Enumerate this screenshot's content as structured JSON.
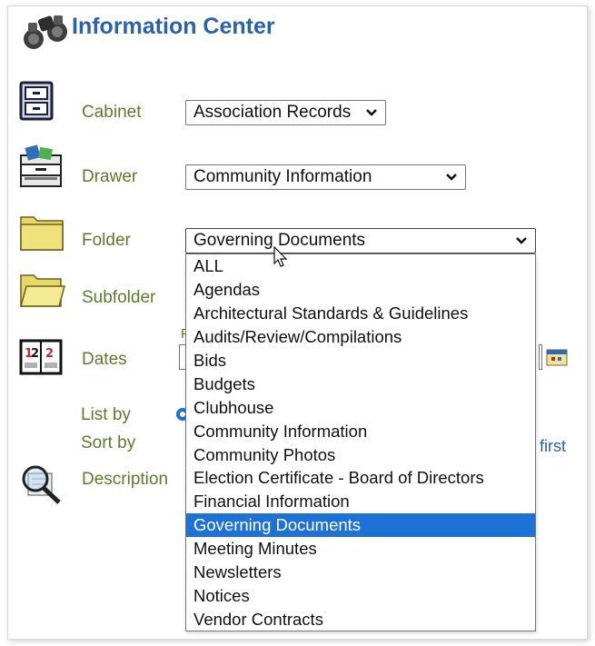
{
  "header": {
    "title": "Information Center",
    "icon": "binoculars-icon"
  },
  "fields": {
    "cabinet": {
      "label": "Cabinet",
      "value": "Association Records"
    },
    "drawer": {
      "label": "Drawer",
      "value": "Community Information"
    },
    "folder": {
      "label": "Folder",
      "value": "Governing Documents"
    },
    "subfolder": {
      "label": "Subfolder"
    },
    "dates": {
      "label": "Dates",
      "partial_text": "F"
    },
    "list_by": {
      "label": "List by"
    },
    "sort_by": {
      "label": "Sort by",
      "link_text": "first"
    },
    "description": {
      "label": "Description"
    }
  },
  "folder_options": [
    "ALL",
    "Agendas",
    "Architectural Standards & Guidelines",
    "Audits/Review/Compilations",
    "Bids",
    "Budgets",
    "Clubhouse",
    "Community Information",
    "Community Photos",
    "Election Certificate - Board of Directors",
    "Financial Information",
    "Governing Documents",
    "Meeting Minutes",
    "Newsletters",
    "Notices",
    "Vendor Contracts"
  ],
  "selected_index": 11,
  "colors": {
    "title": "#2a63a8",
    "label": "#5b7c2a",
    "highlight": "#1e72d6"
  }
}
